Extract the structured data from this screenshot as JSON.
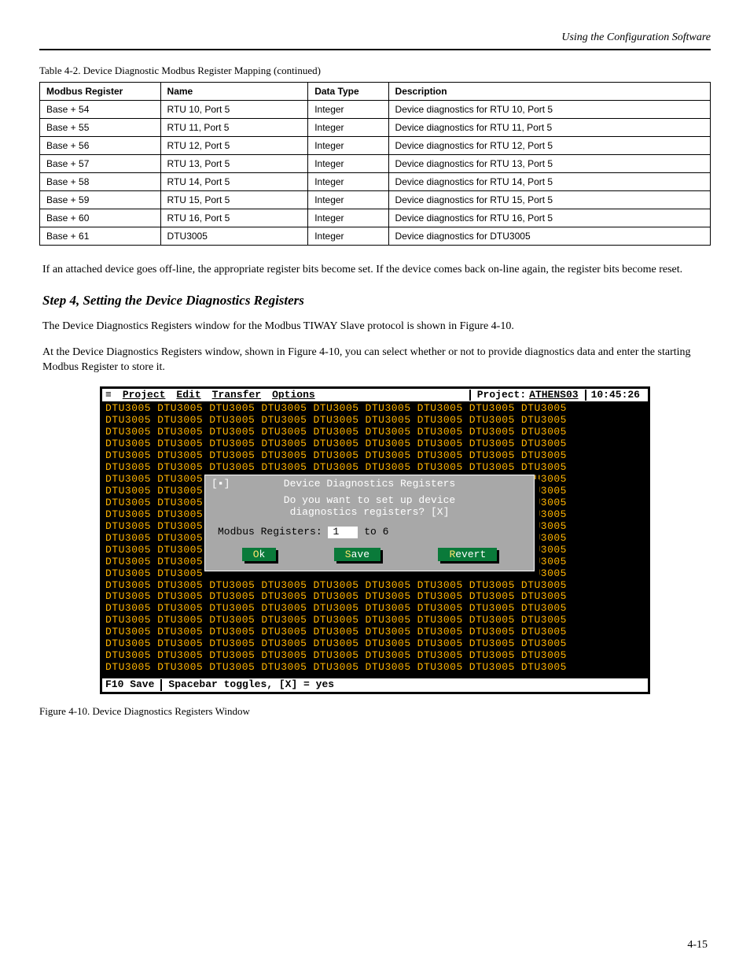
{
  "header": {
    "section_title": "Using the Configuration Software"
  },
  "table_caption": "Table 4-2.  Device Diagnostic Modbus Register Mapping (continued)",
  "table": {
    "columns": [
      "Modbus Register",
      "Name",
      "Data Type",
      "Description"
    ],
    "rows": [
      {
        "reg": "Base + 54",
        "name": "RTU 10, Port 5",
        "type": "Integer",
        "desc": "Device diagnostics for RTU 10, Port 5"
      },
      {
        "reg": "Base + 55",
        "name": "RTU 11, Port 5",
        "type": "Integer",
        "desc": "Device diagnostics for RTU 11, Port 5"
      },
      {
        "reg": "Base + 56",
        "name": "RTU 12, Port 5",
        "type": "Integer",
        "desc": "Device diagnostics for RTU 12, Port 5"
      },
      {
        "reg": "Base + 57",
        "name": "RTU 13, Port 5",
        "type": "Integer",
        "desc": "Device diagnostics for RTU 13, Port 5"
      },
      {
        "reg": "Base + 58",
        "name": "RTU 14, Port 5",
        "type": "Integer",
        "desc": "Device diagnostics for RTU 14, Port 5"
      },
      {
        "reg": "Base + 59",
        "name": "RTU 15, Port 5",
        "type": "Integer",
        "desc": "Device diagnostics for RTU 15, Port 5"
      },
      {
        "reg": "Base + 60",
        "name": "RTU 16, Port 5",
        "type": "Integer",
        "desc": "Device diagnostics for RTU 16, Port 5"
      },
      {
        "reg": "Base + 61",
        "name": "DTU3005",
        "type": "Integer",
        "desc": "Device diagnostics for DTU3005"
      }
    ]
  },
  "paragraphs": [
    "If an attached device goes off-line, the appropriate register bits become set. If the device comes back on-line again, the register bits become reset.",
    "The Device Diagnostics Registers window for the Modbus TIWAY Slave protocol is shown in Figure 4-10."
  ],
  "heading": "Step 4, Setting the Device Diagnostics Registers",
  "para3": "At the Device Diagnostics Registers window, shown in Figure 4-10, you can select whether or not to provide diagnostics data and enter the starting Modbus Register to store it.",
  "dos": {
    "menu": [
      "≡",
      "Project",
      "Edit",
      "Transfer",
      "Options"
    ],
    "project_label": "Project:",
    "project_value": "ATHENS03",
    "clock": "10:45:26",
    "bg_token": "DTU3005",
    "dialog": {
      "title": "Device Diagnostics Registers",
      "close_glyph": "[▪]",
      "question_l1": "Do you want to set up device",
      "question_l2": "diagnostics registers?  [X]",
      "field_label": "Modbus Registers:",
      "field_value": "1",
      "field_suffix": "to 6",
      "buttons": {
        "ok": "Ok",
        "save": "Save",
        "revert": "Revert"
      }
    },
    "status_left": "F10 Save",
    "status_right": "Spacebar toggles, [X] = yes"
  },
  "figure_caption": "Figure 4-10.  Device Diagnostics Registers Window",
  "page_number": "4-15"
}
